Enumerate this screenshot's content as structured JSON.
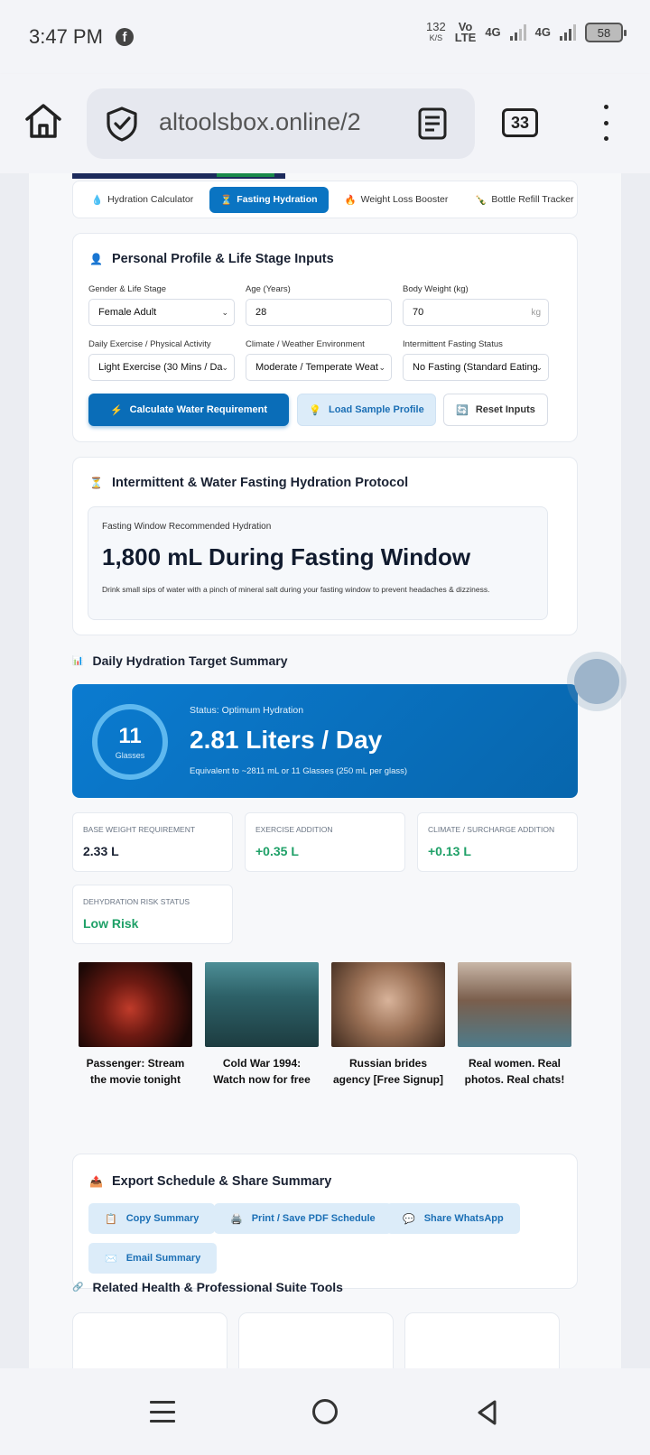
{
  "status": {
    "time": "3:47 PM",
    "speed_value": "132",
    "speed_unit": "K/S",
    "net1": "Vo",
    "net1_sub": "LTE",
    "net2": "4G",
    "net3": "4G",
    "battery": "58"
  },
  "browser": {
    "url": "altoolsbox.online/2",
    "tab_count": "33"
  },
  "tabs": [
    {
      "icon": "💧",
      "label": "Hydration Calculator"
    },
    {
      "icon": "⏳",
      "label": "Fasting Hydration"
    },
    {
      "icon": "🔥",
      "label": "Weight Loss Booster"
    },
    {
      "icon": "🍾",
      "label": "Bottle Refill Tracker"
    }
  ],
  "profile": {
    "icon": "👤",
    "title": "Personal Profile & Life Stage Inputs",
    "gender_label": "Gender & Life Stage",
    "gender_value": "Female Adult",
    "age_label": "Age (Years)",
    "age_value": "28",
    "weight_label": "Body Weight (kg)",
    "weight_value": "70",
    "weight_unit": "kg",
    "exercise_label": "Daily Exercise / Physical Activity",
    "exercise_value": "Light Exercise (30 Mins / Da",
    "climate_label": "Climate / Weather Environment",
    "climate_value": "Moderate / Temperate Weat",
    "fasting_label": "Intermittent Fasting Status",
    "fasting_value": "No Fasting (Standard Eating",
    "calc_icon": "⚡",
    "calc_btn": "Calculate Water Requirement",
    "sample_icon": "💡",
    "sample_btn": "Load Sample Profile",
    "reset_icon": "🔄",
    "reset_btn": "Reset Inputs"
  },
  "fasting": {
    "icon": "⏳",
    "title": "Intermittent & Water Fasting Hydration Protocol",
    "box_label": "Fasting Window Recommended Hydration",
    "box_value": "1,800 mL During Fasting Window",
    "box_note": "Drink small sips of water with a pinch of mineral salt during your fasting window to prevent headaches & dizziness."
  },
  "summary": {
    "icon": "📊",
    "title": "Daily Hydration Target Summary",
    "glasses": "11",
    "glasses_label": "Glasses",
    "status": "Status: Optimum Hydration",
    "liters": "2.81 Liters / Day",
    "equivalent": "Equivalent to ~2811 mL or 11 Glasses (250 mL per glass)"
  },
  "stats": [
    {
      "label": "Base Weight Requirement",
      "value": "2.33 L"
    },
    {
      "label": "Exercise Addition",
      "value": "+0.35 L"
    },
    {
      "label": "Climate / Surcharge Addition",
      "value": "+0.13 L"
    },
    {
      "label": "Dehydration Risk Status",
      "value": "Low Risk"
    }
  ],
  "ads": [
    {
      "line1": "Passenger: Stream",
      "line2": "the movie tonight"
    },
    {
      "line1": "Cold War 1994:",
      "line2": "Watch now for free"
    },
    {
      "line1": "Russian brides",
      "line2": "agency [Free Signup]"
    },
    {
      "line1": "Real women. Real",
      "line2": "photos. Real chats!"
    }
  ],
  "export": {
    "icon": "📤",
    "title": "Export Schedule & Share Summary",
    "copy_icon": "📋",
    "copy": "Copy Summary",
    "print_icon": "🖨️",
    "print": "Print / Save PDF Schedule",
    "share_icon": "💬",
    "share": "Share WhatsApp",
    "email_icon": "✉️",
    "email": "Email Summary"
  },
  "related": {
    "icon": "🔗",
    "title": "Related Health & Professional Suite Tools"
  },
  "colors": {
    "primary": "#0a6db8",
    "accent_green": "#1ea067",
    "light_button": "#dcecf9"
  }
}
